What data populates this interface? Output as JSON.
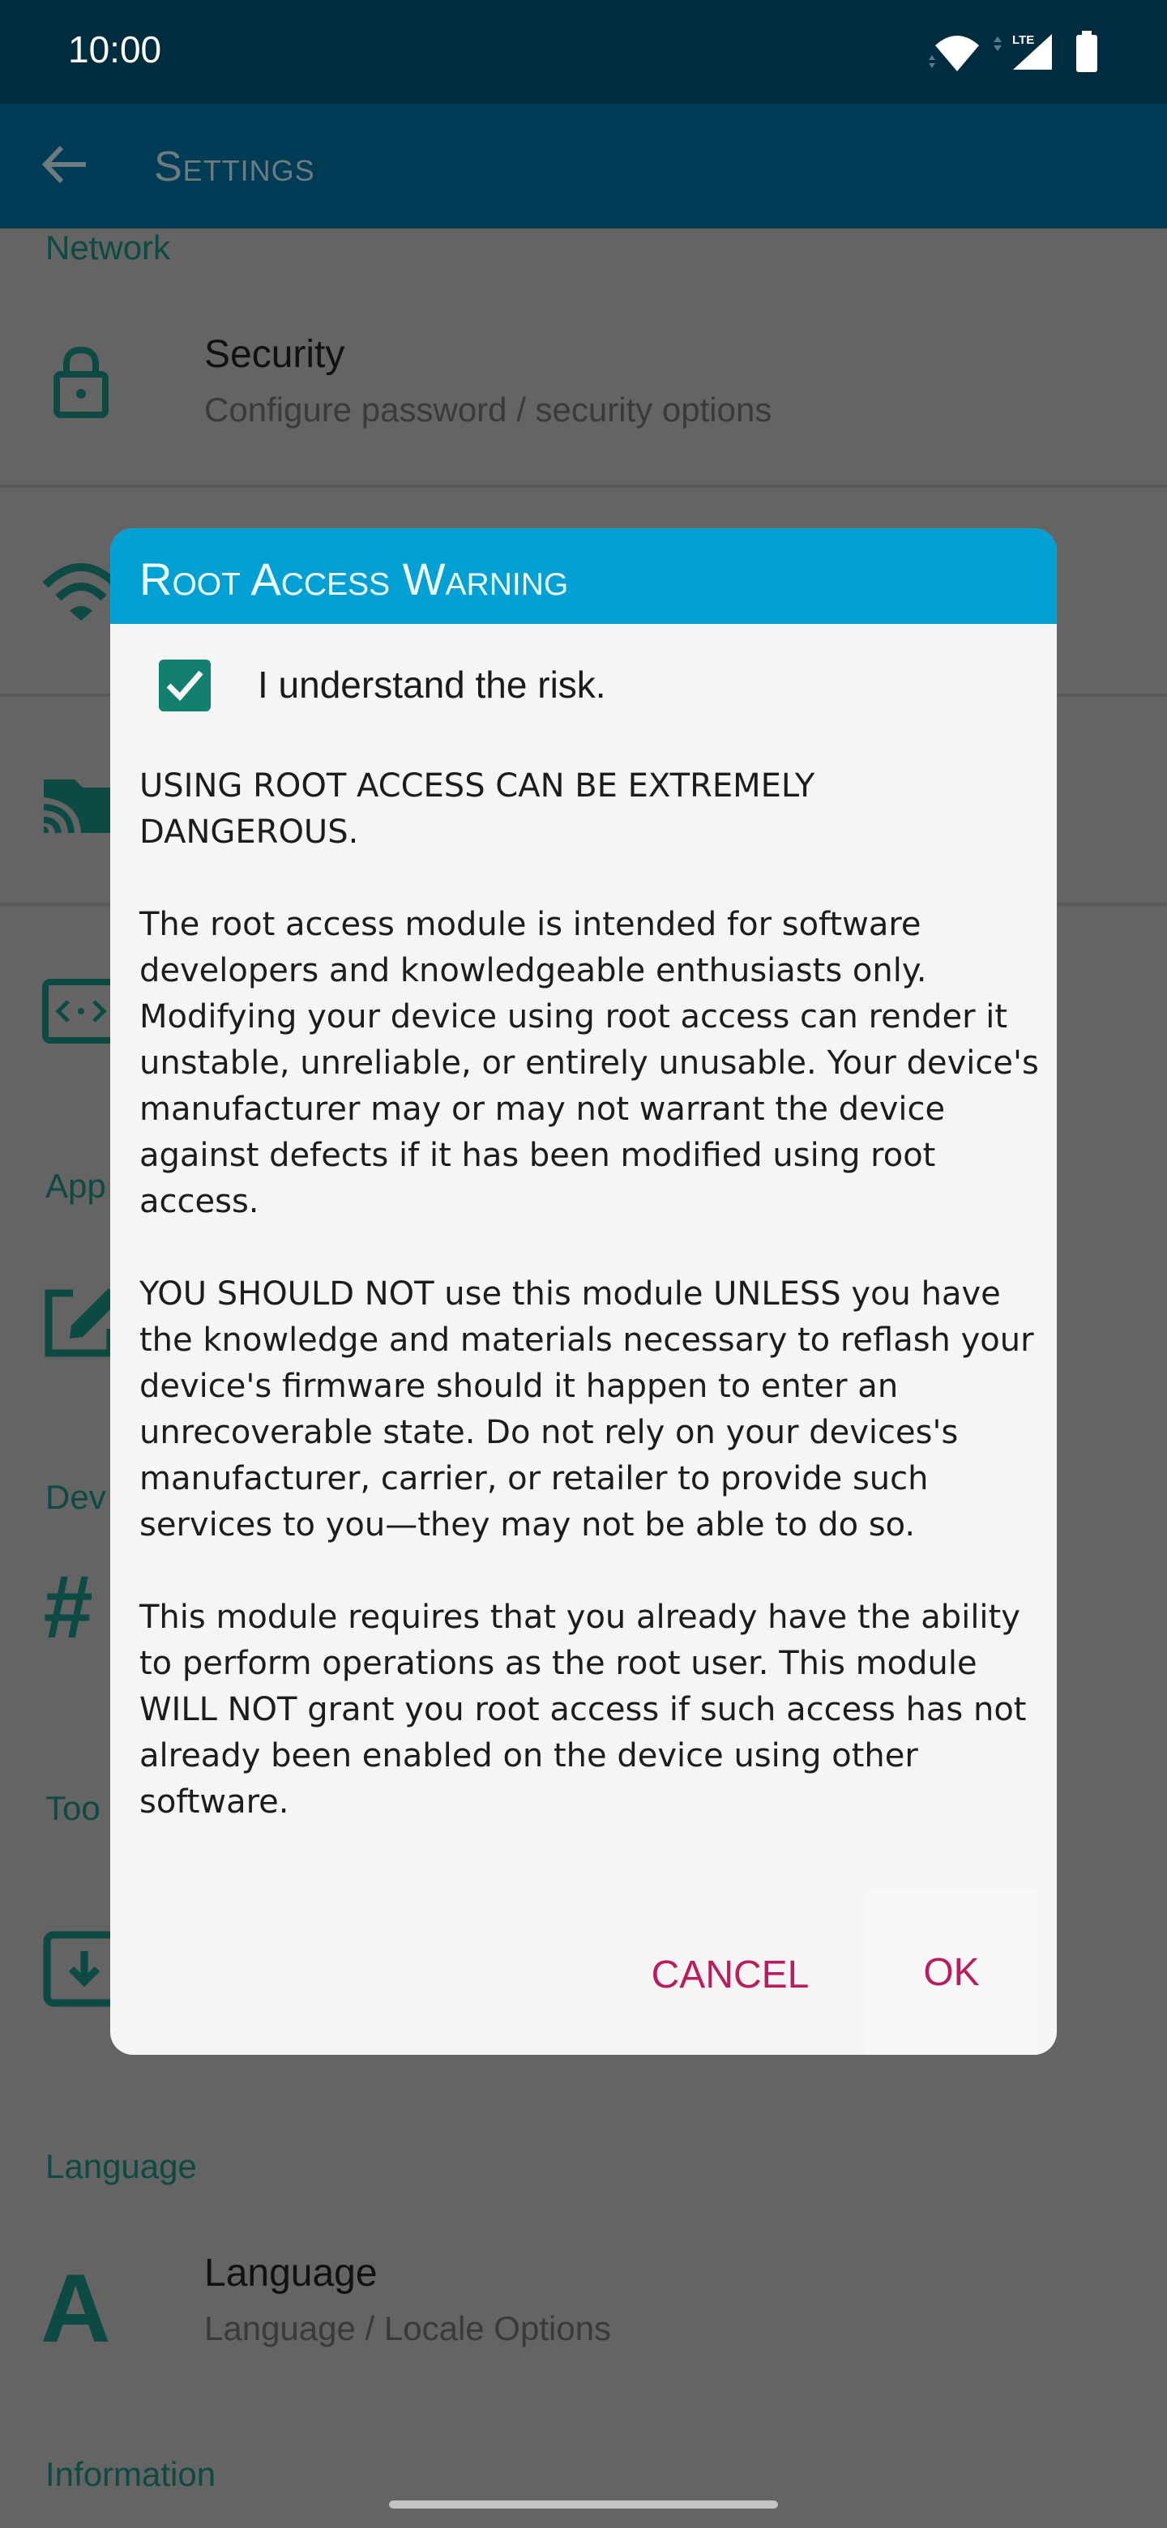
{
  "status_bar": {
    "time": "10:00",
    "network_label": "LTE",
    "icons": [
      "wifi-icon",
      "cellular-signal-icon",
      "battery-icon"
    ]
  },
  "app_bar": {
    "title": "Settings",
    "back_icon": "arrow-left-icon"
  },
  "settings_list": {
    "sections": [
      {
        "header": "Network",
        "items": [
          {
            "title": "Security",
            "subtitle": "Configure password / security options",
            "icon": "lock-icon"
          },
          {
            "title": "",
            "subtitle": "",
            "icon": "wifi-icon"
          },
          {
            "title": "",
            "subtitle": "",
            "icon": "cast-icon"
          },
          {
            "title": "",
            "subtitle": "",
            "icon": "code-icon"
          }
        ]
      },
      {
        "header": "App",
        "items": [
          {
            "title": "",
            "subtitle": "",
            "icon": "edit-icon"
          }
        ]
      },
      {
        "header": "Dev",
        "items": [
          {
            "title": "",
            "subtitle": "",
            "icon": "hash-icon"
          }
        ]
      },
      {
        "header": "Too",
        "items": [
          {
            "title": "",
            "subtitle": "",
            "icon": "download-icon"
          }
        ]
      },
      {
        "header": "Language",
        "items": [
          {
            "title": "Language",
            "subtitle": "Language / Locale Options",
            "icon": "language-a-icon"
          }
        ]
      },
      {
        "header": "Information",
        "items": []
      }
    ]
  },
  "dialog": {
    "title": "Root Access Warning",
    "checkbox": {
      "label": "I understand the risk.",
      "checked": true
    },
    "paragraphs": [
      "USING ROOT ACCESS CAN BE EXTREMELY DANGEROUS.",
      "The root access module is intended for software developers and knowledgeable enthusiasts only. Modifying your device using root access can render it unstable, unreliable, or entirely unusable. Your device's manufacturer may or may not warrant the device against defects if it has been modified using root access.",
      "YOU SHOULD NOT use this module UNLESS you have the knowledge and materials necessary to reflash your device's firmware should it happen to enter an unrecoverable state. Do not rely on your devices's manufacturer, carrier, or retailer to provide such services to you—they may not be able to do so.",
      "This module requires that you already have the ability to perform operations as the root user. This module WILL NOT grant you root access if such access has not already been enabled on the device using other software."
    ],
    "cancel_label": "CANCEL",
    "ok_label": "OK"
  },
  "colors": {
    "status_bar": "#002c3f",
    "app_bar": "#003c55",
    "scrim": "#646464",
    "icon_teal": "#0d4a44",
    "dialog_header": "#009fd4",
    "dialog_body": "#f5f5f5",
    "checkbox": "#137f6f",
    "button_accent": "#b91d5e"
  }
}
